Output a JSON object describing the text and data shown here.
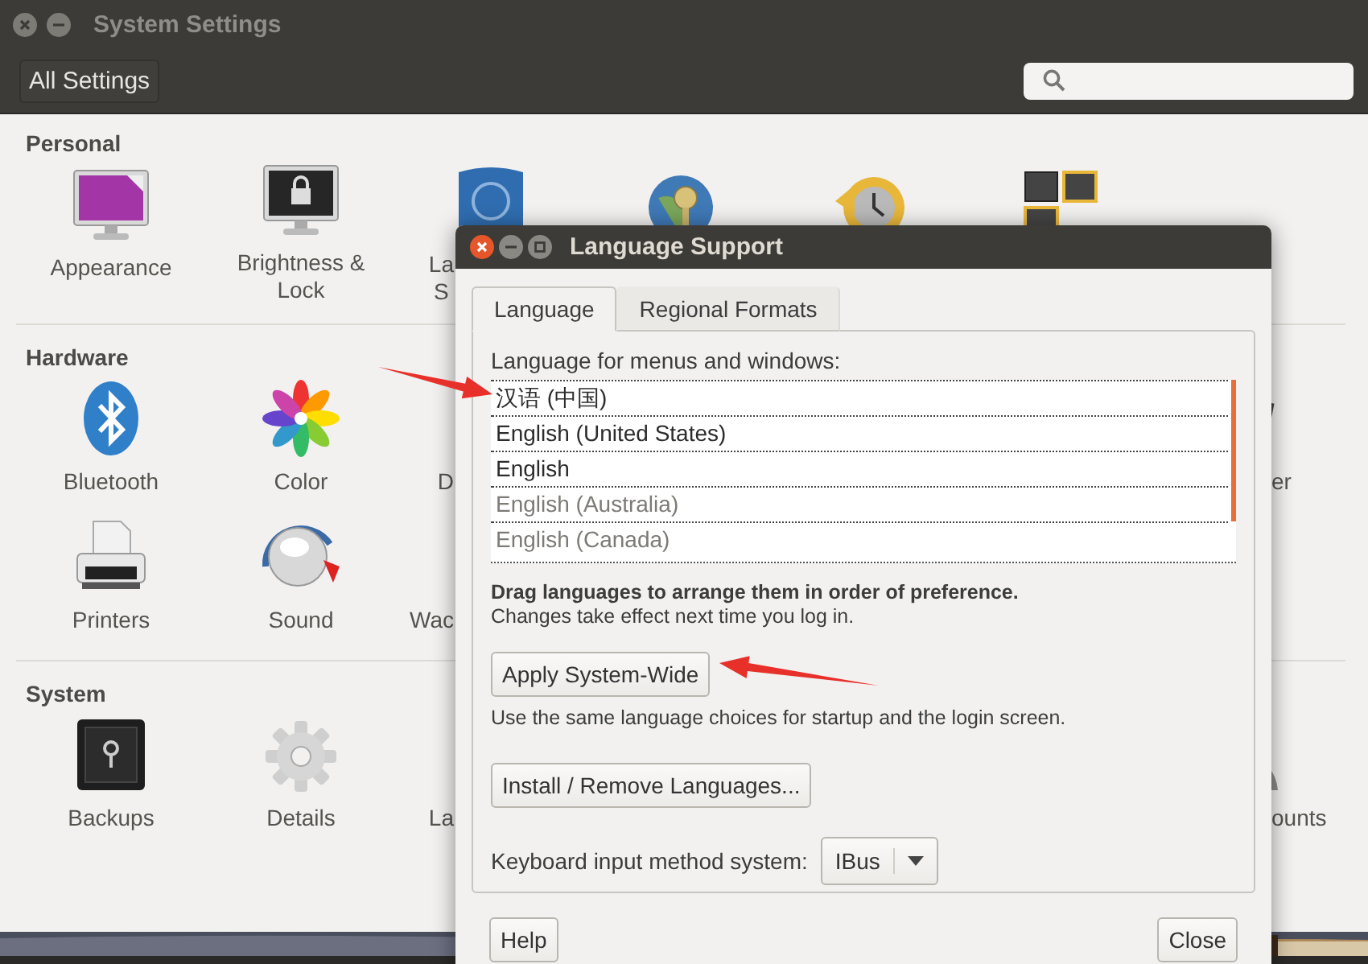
{
  "settings_window": {
    "title": "System Settings",
    "all_settings_button": "All Settings",
    "sections": [
      {
        "heading": "Personal",
        "items": [
          {
            "label": "Appearance"
          },
          {
            "label": "Brightness &\nLock"
          },
          {
            "label": "La\nS"
          }
        ]
      },
      {
        "heading": "Hardware",
        "items": [
          {
            "label": "Bluetooth"
          },
          {
            "label": "Color"
          },
          {
            "label": "D"
          },
          {
            "label": "er"
          },
          {
            "label": "Printers"
          },
          {
            "label": "Sound"
          },
          {
            "label": "Wac"
          }
        ]
      },
      {
        "heading": "System",
        "items": [
          {
            "label": "Backups"
          },
          {
            "label": "Details"
          },
          {
            "label": "La"
          },
          {
            "label": "ounts"
          }
        ]
      }
    ]
  },
  "dialog": {
    "title": "Language Support",
    "tabs": [
      {
        "label": "Language",
        "selected": true
      },
      {
        "label": "Regional Formats",
        "selected": false
      }
    ],
    "list_label": "Language for menus and windows:",
    "languages": [
      {
        "name": "汉语 (中国)",
        "installed": true
      },
      {
        "name": "English (United States)",
        "installed": true
      },
      {
        "name": "English",
        "installed": true
      },
      {
        "name": "English (Australia)",
        "installed": false
      },
      {
        "name": "English (Canada)",
        "installed": false
      }
    ],
    "drag_hint": "Drag languages to arrange them in order of preference.",
    "restart_note": "Changes take effect next time you log in.",
    "apply_button": "Apply System-Wide",
    "apply_note": "Use the same language choices for startup and the login screen.",
    "install_button": "Install / Remove Languages...",
    "input_method": {
      "label": "Keyboard input method system:",
      "value": "IBus"
    },
    "help_button": "Help",
    "close_button": "Close"
  }
}
